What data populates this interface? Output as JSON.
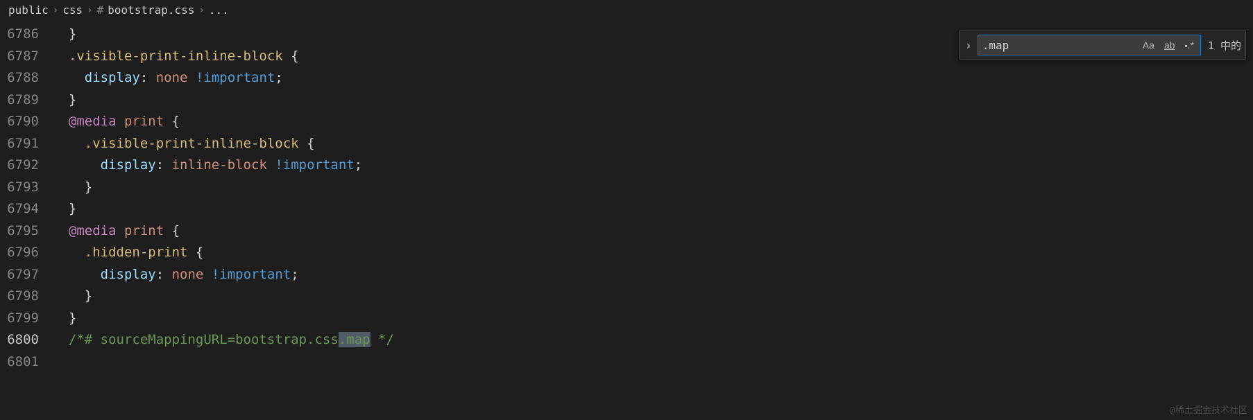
{
  "breadcrumb": {
    "items": [
      "public",
      "css",
      "bootstrap.css",
      "..."
    ],
    "hash": "#"
  },
  "find": {
    "value": ".map",
    "case_label": "Aa",
    "word_label": "ab",
    "regex_label": ".*",
    "count": "1 中的"
  },
  "gutter": {
    "l0": "6786",
    "l1": "6787",
    "l2": "6788",
    "l3": "6789",
    "l4": "6790",
    "l5": "6791",
    "l6": "6792",
    "l7": "6793",
    "l8": "6794",
    "l9": "6795",
    "l10": "6796",
    "l11": "6797",
    "l12": "6798",
    "l13": "6799",
    "l14": "6800",
    "l15": "6801"
  },
  "code": {
    "l0": "  }",
    "l1": {
      "sel": ".visible-print-inline-block",
      "open": " {"
    },
    "l2": {
      "indent": "    ",
      "prop": "display",
      "colon": ": ",
      "val": "none",
      "sp": " ",
      "imp": "!important",
      "semi": ";"
    },
    "l3": "  }",
    "l4": {
      "at": "@media",
      "sp": " ",
      "val": "print",
      "open": " {"
    },
    "l5": {
      "indent": "    ",
      "sel": ".visible-print-inline-block",
      "open": " {"
    },
    "l6": {
      "indent": "      ",
      "prop": "display",
      "colon": ": ",
      "val": "inline-block",
      "sp": " ",
      "imp": "!important",
      "semi": ";"
    },
    "l7": "    }",
    "l8": "  }",
    "l9": {
      "at": "@media",
      "sp": " ",
      "val": "print",
      "open": " {"
    },
    "l10": {
      "indent": "    ",
      "sel": ".hidden-print",
      "open": " {"
    },
    "l11": {
      "indent": "      ",
      "prop": "display",
      "colon": ": ",
      "val": "none",
      "sp": " ",
      "imp": "!important",
      "semi": ";"
    },
    "l12": "    }",
    "l13": "  }",
    "l14": {
      "open": "  /*# sourceMappingURL=bootstrap.css",
      "hl": ".map",
      "close": " */"
    }
  },
  "watermark": "@稀土掘金技术社区"
}
